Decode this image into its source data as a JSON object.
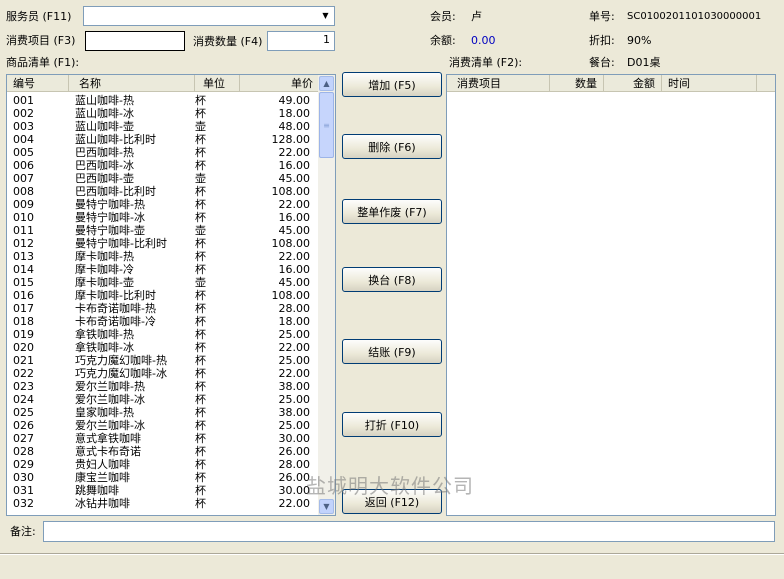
{
  "header": {
    "server_label": "服务员 (F11)",
    "server_value": "",
    "item_label": "消费项目 (F3)",
    "item_value": "",
    "qty_label": "消费数量 (F4)",
    "qty_value": "1",
    "member_label": "会员:",
    "member_value": "卢",
    "balance_label": "余额:",
    "balance_value": "0.00",
    "order_no_label": "单号:",
    "order_no_value": "SC0100201101030000001",
    "discount_label": "折扣:",
    "discount_value": "90%",
    "table_label": "餐台:",
    "table_value": "D01桌"
  },
  "product_list": {
    "title": "商品清单 (F1):",
    "columns": [
      "编号",
      "名称",
      "单位",
      "单价"
    ],
    "rows": [
      [
        "001",
        "蓝山咖啡-热",
        "杯",
        "49.00"
      ],
      [
        "002",
        "蓝山咖啡-冰",
        "杯",
        "18.00"
      ],
      [
        "003",
        "蓝山咖啡-壶",
        "壶",
        "48.00"
      ],
      [
        "004",
        "蓝山咖啡-比利时",
        "杯",
        "128.00"
      ],
      [
        "005",
        "巴西咖啡-热",
        "杯",
        "22.00"
      ],
      [
        "006",
        "巴西咖啡-冰",
        "杯",
        "16.00"
      ],
      [
        "007",
        "巴西咖啡-壶",
        "壶",
        "45.00"
      ],
      [
        "008",
        "巴西咖啡-比利时",
        "杯",
        "108.00"
      ],
      [
        "009",
        "曼特宁咖啡-热",
        "杯",
        "22.00"
      ],
      [
        "010",
        "曼特宁咖啡-冰",
        "杯",
        "16.00"
      ],
      [
        "011",
        "曼特宁咖啡-壶",
        "壶",
        "45.00"
      ],
      [
        "012",
        "曼特宁咖啡-比利时",
        "杯",
        "108.00"
      ],
      [
        "013",
        "摩卡咖啡-热",
        "杯",
        "22.00"
      ],
      [
        "014",
        "摩卡咖啡-冷",
        "杯",
        "16.00"
      ],
      [
        "015",
        "摩卡咖啡-壶",
        "壶",
        "45.00"
      ],
      [
        "016",
        "摩卡咖啡-比利时",
        "杯",
        "108.00"
      ],
      [
        "017",
        "卡布奇诺咖啡-热",
        "杯",
        "28.00"
      ],
      [
        "018",
        "卡布奇诺咖啡-冷",
        "杯",
        "18.00"
      ],
      [
        "019",
        "拿铁咖啡-热",
        "杯",
        "25.00"
      ],
      [
        "020",
        "拿铁咖啡-冰",
        "杯",
        "22.00"
      ],
      [
        "021",
        "巧克力魔幻咖啡-热",
        "杯",
        "25.00"
      ],
      [
        "022",
        "巧克力魔幻咖啡-冰",
        "杯",
        "22.00"
      ],
      [
        "023",
        "爱尔兰咖啡-热",
        "杯",
        "38.00"
      ],
      [
        "024",
        "爱尔兰咖啡-冰",
        "杯",
        "25.00"
      ],
      [
        "025",
        "皇家咖啡-热",
        "杯",
        "38.00"
      ],
      [
        "026",
        "爱尔兰咖啡-冰",
        "杯",
        "25.00"
      ],
      [
        "027",
        "意式拿铁咖啡",
        "杯",
        "30.00"
      ],
      [
        "028",
        "意式卡布奇诺",
        "杯",
        "26.00"
      ],
      [
        "029",
        "贵妇人咖啡",
        "杯",
        "28.00"
      ],
      [
        "030",
        "康宝兰咖啡",
        "杯",
        "26.00"
      ],
      [
        "031",
        "跳舞咖啡",
        "杯",
        "30.00"
      ],
      [
        "032",
        "冰钻井咖啡",
        "杯",
        "22.00"
      ]
    ]
  },
  "consume_list": {
    "title": "消费清单 (F2):",
    "columns": [
      "消费项目",
      "数量",
      "金额",
      "时间"
    ]
  },
  "buttons": {
    "add": "增加 (F5)",
    "delete": "删除 (F6)",
    "void": "整单作废 (F7)",
    "change_table": "换台 (F8)",
    "checkout": "结账 (F9)",
    "discount": "打折 (F10)",
    "back": "返回 (F12)"
  },
  "footer": {
    "note_label": "备注:",
    "note_value": ""
  },
  "watermark": "盐城明大软件公司",
  "colors": {
    "window_bg": "#ece9d8",
    "balance_color": "#0000c0",
    "field_border": "#7f9db9"
  }
}
